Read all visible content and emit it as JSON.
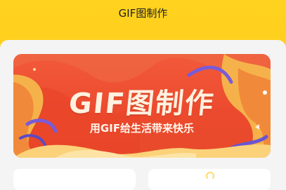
{
  "nav": {
    "title": "GIF图制作"
  },
  "banner": {
    "title": "GIF图制作",
    "subtitle": "用GIF给生活带来快乐"
  },
  "colors": {
    "header": "#ffd21f",
    "banner_bg": "#ec4a2e",
    "banner_text": "#fff1e0",
    "page_bg": "#f4f4f4"
  },
  "cards": [
    {
      "icon": "blank"
    },
    {
      "icon": "gif-tool-icon"
    }
  ]
}
